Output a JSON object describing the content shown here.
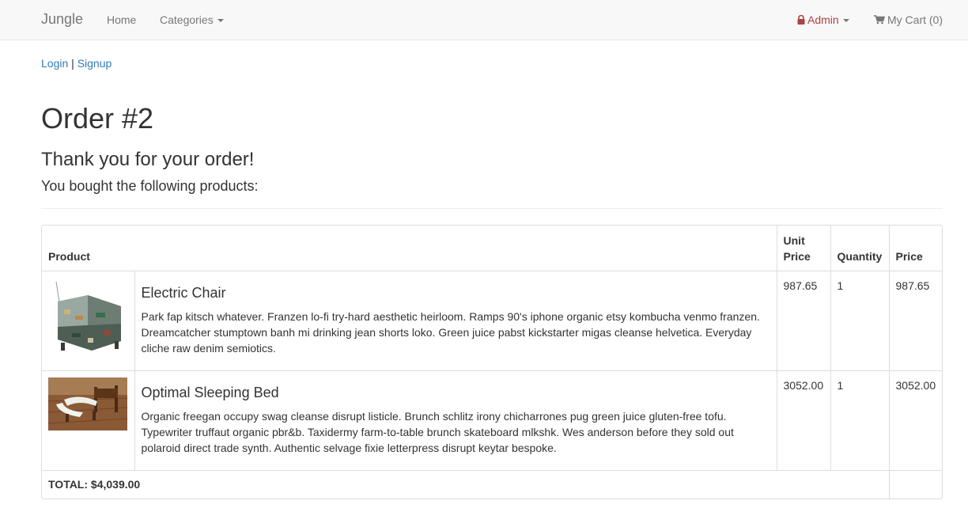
{
  "navbar": {
    "brand": "Jungle",
    "home_label": "Home",
    "categories_label": "Categories",
    "admin_label": "Admin",
    "cart_label": "My Cart (0)"
  },
  "auth": {
    "login_label": "Login",
    "separator": "|",
    "signup_label": "Signup"
  },
  "order": {
    "title": "Order #2",
    "thanks": "Thank you for your order!",
    "subtitle": "You bought the following products:"
  },
  "table": {
    "headers": {
      "product": "Product",
      "unit_price": "Unit Price",
      "quantity": "Quantity",
      "price": "Price"
    },
    "items": [
      {
        "name": "Electric Chair",
        "description": "Park fap kitsch whatever. Franzen lo-fi try-hard aesthetic heirloom. Ramps 90's iphone organic etsy kombucha venmo franzen. Dreamcatcher stumptown banh mi drinking jean shorts loko. Green juice pabst kickstarter migas cleanse helvetica. Everyday cliche raw denim semiotics.",
        "unit_price": "987.65",
        "quantity": "1",
        "price": "987.65"
      },
      {
        "name": "Optimal Sleeping Bed",
        "description": "Organic freegan occupy swag cleanse disrupt listicle. Brunch schlitz irony chicharrones pug green juice gluten-free tofu. Typewriter truffaut organic pbr&b. Taxidermy farm-to-table brunch skateboard mlkshk. Wes anderson before they sold out polaroid direct trade synth. Authentic selvage fixie letterpress disrupt keytar bespoke.",
        "unit_price": "3052.00",
        "quantity": "1",
        "price": "3052.00"
      }
    ],
    "total": "TOTAL: $4,039.00"
  },
  "colors": {
    "link": "#337ab7",
    "admin": "#a94442",
    "navbar_bg": "#f8f8f8",
    "border": "#dddddd"
  },
  "icons": {
    "admin": "lock-icon",
    "cart": "shopping-cart-icon"
  }
}
